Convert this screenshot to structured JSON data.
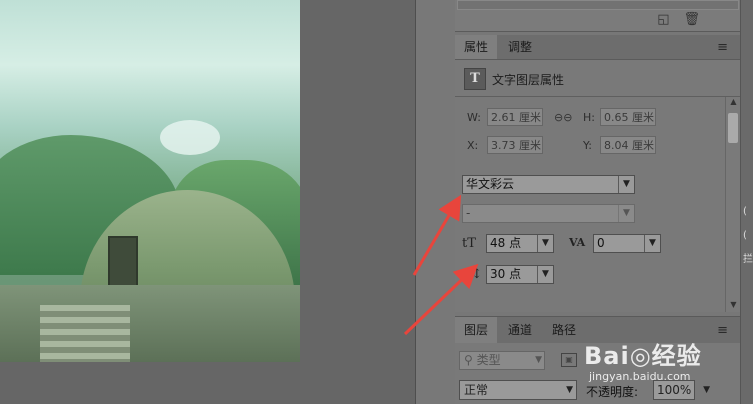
{
  "properties_panel": {
    "tabs": [
      "属性",
      "调整"
    ],
    "header_title": "文字图层属性",
    "dimensions": {
      "w_label": "W:",
      "w_value": "2.61 厘米",
      "h_label": "H:",
      "h_value": "0.65 厘米",
      "x_label": "X:",
      "x_value": "3.73 厘米",
      "y_label": "Y:",
      "y_value": "8.04 厘米"
    },
    "font_family": "华文彩云",
    "font_style": "-",
    "font_size": "48 点",
    "tracking": "0",
    "leading": "30 点"
  },
  "layers_panel": {
    "tabs": [
      "图层",
      "通道",
      "路径"
    ],
    "filter_placeholder": "类型",
    "blend_mode": "正常",
    "opacity_label": "不透明度:",
    "opacity_value": "100%"
  },
  "watermark": {
    "main": "Bai◎经验",
    "sub": "jingyan.baidu.com"
  },
  "right_edge_chars": [
    "(",
    "(",
    "拦"
  ],
  "colors": {
    "panel_bg": "#777777",
    "canvas_bg": "#666666",
    "arrow": "#e8453c"
  },
  "icons": {
    "type_layer": "T",
    "font_size": "tT",
    "tracking": "VA",
    "leading": "A↕"
  }
}
